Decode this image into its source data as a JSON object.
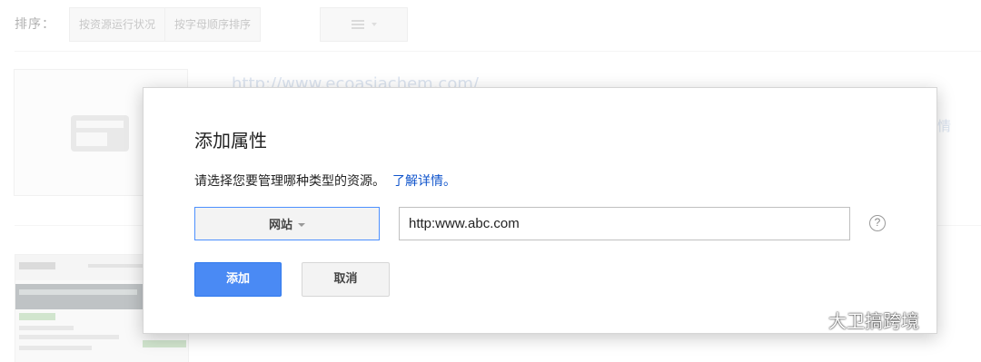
{
  "toolbar": {
    "sort_label": "排序：",
    "sort_by_status": "按资源运行状况",
    "sort_by_alpha": "按字母顺序排序"
  },
  "background": {
    "site_url": "http://www.ecoasiachem.com/",
    "side_link": "情"
  },
  "dialog": {
    "title": "添加属性",
    "description": "请选择您要管理哪种类型的资源。",
    "learn_more": "了解详情。",
    "type_select_value": "网站",
    "url_input_value": "http:www.abc.com",
    "help_icon_glyph": "?",
    "add_label": "添加",
    "cancel_label": "取消"
  },
  "watermark": {
    "text": "大卫搞跨境"
  },
  "colors": {
    "primary_button": "#4a8af4",
    "link": "#1155cc",
    "select_border": "#4d90fe"
  },
  "icons": [
    "list-view-icon",
    "site-placeholder-icon",
    "help-icon",
    "wechat-icon",
    "chevron-down-icon"
  ]
}
